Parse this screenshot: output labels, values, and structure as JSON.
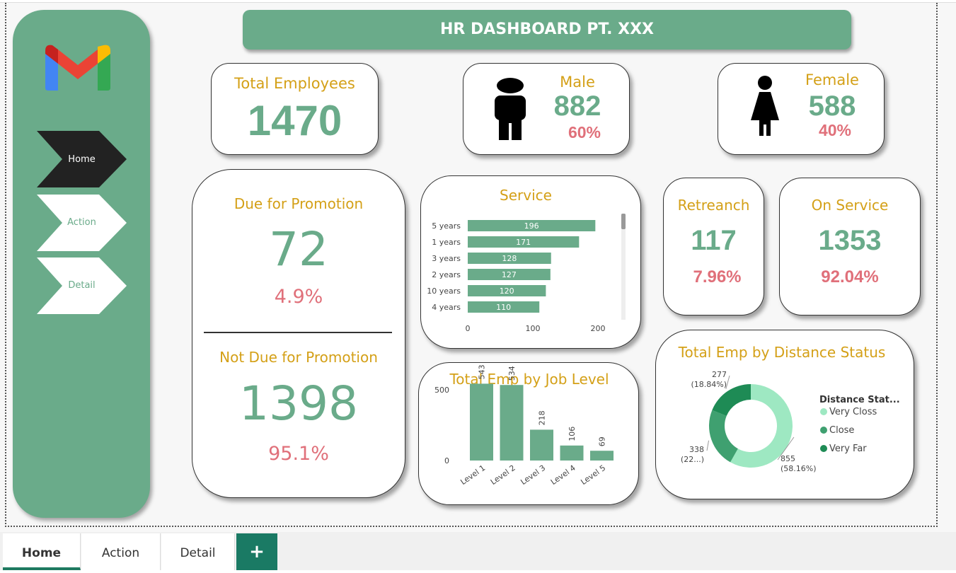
{
  "app": {
    "title": "HR DASHBOARD PT. XXX"
  },
  "sidebar": {
    "logo": "gmail-logo-icon",
    "nav": [
      {
        "label": "Home",
        "active": true
      },
      {
        "label": "Action",
        "active": false
      },
      {
        "label": "Detail",
        "active": false
      }
    ]
  },
  "kpi": {
    "total_employees": {
      "label": "Total Employees",
      "value": "1470"
    },
    "male": {
      "label": "Male",
      "value": "882",
      "pct": "60%",
      "icon": "male-person-icon"
    },
    "female": {
      "label": "Female",
      "value": "588",
      "pct": "40%",
      "icon": "female-person-icon"
    },
    "promotion": {
      "due_label": "Due for Promotion",
      "due_value": "72",
      "due_pct": "4.9%",
      "not_due_label": "Not Due for Promotion",
      "not_due_value": "1398",
      "not_due_pct": "95.1%"
    },
    "retrench": {
      "label": "Retreanch",
      "value": "117",
      "pct": "7.96%"
    },
    "on_service": {
      "label": "On Service",
      "value": "1353",
      "pct": "92.04%"
    }
  },
  "colors": {
    "accent": "#6aab8a",
    "gold": "#d4a017",
    "red": "#e0707a",
    "dark_tab": "#1a7a64"
  },
  "chart_data": [
    {
      "type": "bar",
      "orientation": "horizontal",
      "title": "Service",
      "categories": [
        "5 years",
        "1 years",
        "3 years",
        "2 years",
        "10 years",
        "4 years"
      ],
      "values": [
        196,
        171,
        128,
        127,
        120,
        110
      ],
      "xlim": [
        0,
        200
      ],
      "xticks": [
        "0",
        "100",
        "200"
      ]
    },
    {
      "type": "bar",
      "title": "Total Emp by Job Level",
      "categories": [
        "Level 1",
        "Level 2",
        "Level 3",
        "Level 4",
        "Level 5"
      ],
      "values": [
        543,
        534,
        218,
        106,
        69
      ],
      "ylim": [
        0,
        600
      ],
      "yticks": [
        "0",
        "500"
      ]
    },
    {
      "type": "pie",
      "donut": true,
      "title": "Total Emp by Distance Status",
      "legend_title": "Distance Stat...",
      "legend_position": "right",
      "slices": [
        {
          "name": "Very Closs",
          "value": 855,
          "label": "855",
          "pct_label": "(58.16%)",
          "color": "#9ee8c2"
        },
        {
          "name": "Close",
          "value": 338,
          "label": "338",
          "pct_label": "(22...)",
          "color": "#3fa070"
        },
        {
          "name": "Very Far",
          "value": 277,
          "label": "277",
          "pct_label": "(18.84%)",
          "color": "#1e8b55"
        }
      ]
    }
  ],
  "tabs": [
    {
      "label": "Home",
      "active": true
    },
    {
      "label": "Action",
      "active": false
    },
    {
      "label": "Detail",
      "active": false
    }
  ],
  "tab_add": "+"
}
